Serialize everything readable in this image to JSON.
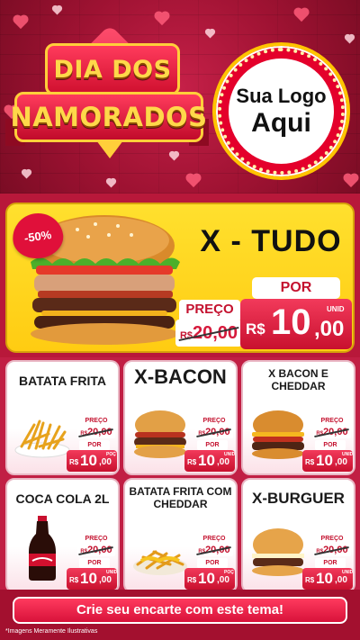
{
  "header": {
    "title_line1": "DIA DOS",
    "title_line2": "NAMORADOS",
    "logo_line1": "Sua Logo",
    "logo_line2": "Aqui"
  },
  "promo": {
    "discount": "-50%",
    "name": "X - TUDO",
    "preco_label": "PREÇO",
    "old_currency": "R$",
    "old_price": "20,00",
    "por_label": "POR",
    "currency": "R$",
    "price_int": "10",
    "price_dec": ",00",
    "unit": "UNID"
  },
  "products": [
    {
      "name": "BATATA FRITA",
      "preco_label": "PREÇO",
      "old_currency": "R$",
      "old_price": "20,00",
      "por_label": "POR",
      "currency": "R$",
      "price_int": "10",
      "price_dec": ",00",
      "unit": "POÇ"
    },
    {
      "name": "X-BACON",
      "preco_label": "PREÇO",
      "old_currency": "R$",
      "old_price": "20,00",
      "por_label": "POR",
      "currency": "R$",
      "price_int": "10",
      "price_dec": ",00",
      "unit": "UNID"
    },
    {
      "name": "X BACON E CHEDDAR",
      "preco_label": "PREÇO",
      "old_currency": "R$",
      "old_price": "20,00",
      "por_label": "POR",
      "currency": "R$",
      "price_int": "10",
      "price_dec": ",00",
      "unit": "UNID"
    },
    {
      "name": "COCA COLA 2L",
      "preco_label": "PREÇO",
      "old_currency": "R$",
      "old_price": "20,00",
      "por_label": "POR",
      "currency": "R$",
      "price_int": "10",
      "price_dec": ",00",
      "unit": "UNID"
    },
    {
      "name": "BATATA FRITA COM CHEDDAR",
      "preco_label": "PREÇO",
      "old_currency": "R$",
      "old_price": "20,00",
      "por_label": "POR",
      "currency": "R$",
      "price_int": "10",
      "price_dec": ",00",
      "unit": "POÇ"
    },
    {
      "name": "X-BURGUER",
      "preco_label": "PREÇO",
      "old_currency": "R$",
      "old_price": "20,00",
      "por_label": "POR",
      "currency": "R$",
      "price_int": "10",
      "price_dec": ",00",
      "unit": "UNID"
    }
  ],
  "cta": "Crie seu encarte com este tema!",
  "disclaimer": "*Imagens Meramente Ilustrativas",
  "colors": {
    "background_red": "#b8183a",
    "promo_yellow": "#ffd51f",
    "price_red": "#d8123a",
    "title_gold": "#ffd84a"
  },
  "icons": [
    "heart-icon",
    "burger-image",
    "fries-image",
    "soda-bottle-image"
  ]
}
